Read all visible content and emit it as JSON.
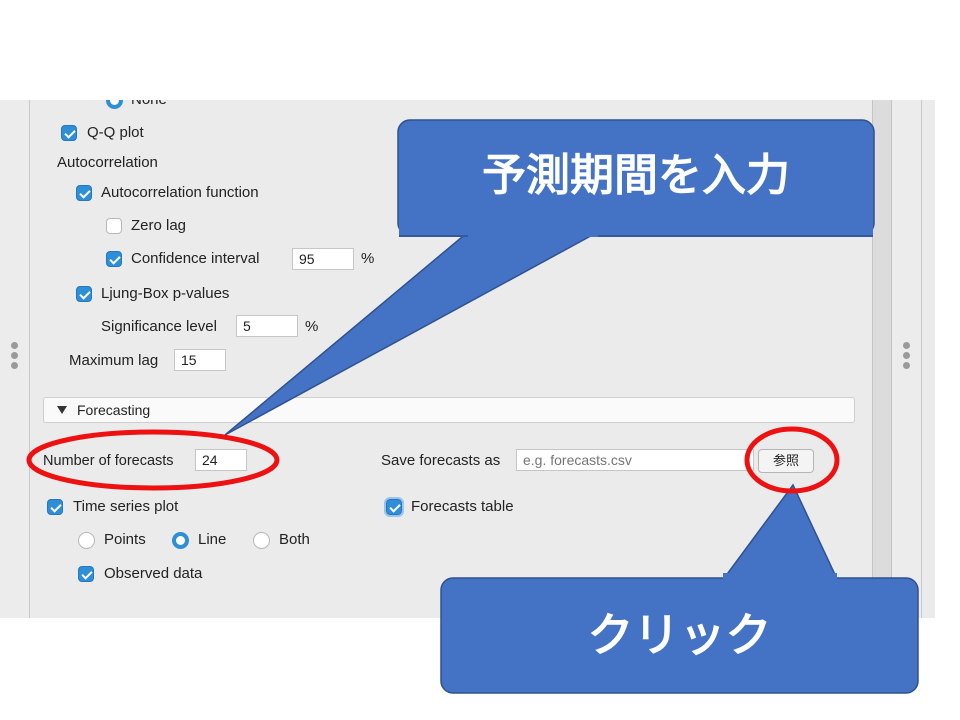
{
  "options": {
    "none_label": "None",
    "qq_plot_label": "Q-Q plot",
    "autocorrelation_heading": "Autocorrelation",
    "acf_label": "Autocorrelation function",
    "zero_lag_label": "Zero lag",
    "confidence_interval_label": "Confidence interval",
    "confidence_interval_value": "95",
    "percent_1": "%",
    "ljung_box_label": "Ljung-Box p-values",
    "significance_level_label": "Significance level",
    "significance_level_value": "5",
    "percent_2": "%",
    "maximum_lag_label": "Maximum lag",
    "maximum_lag_value": "15"
  },
  "forecasting": {
    "section_title": "Forecasting",
    "number_of_forecasts_label": "Number of forecasts",
    "number_of_forecasts_value": "24",
    "save_forecasts_label": "Save forecasts as",
    "save_forecasts_placeholder": "e.g. forecasts.csv",
    "browse_button_label": "参照",
    "time_series_plot_label": "Time series plot",
    "forecasts_table_label": "Forecasts table",
    "points_label": "Points",
    "line_label": "Line",
    "both_label": "Both",
    "observed_data_label": "Observed data"
  },
  "checked": {
    "qq_plot": true,
    "acf": true,
    "zero_lag": false,
    "confidence_interval": true,
    "ljung_box": true,
    "time_series_plot": true,
    "forecasts_table": true,
    "observed_data": true
  },
  "plot_style_selected": "Line",
  "annotations": {
    "callout_top_text": "予測期間を入力",
    "callout_bottom_text": "クリック",
    "callout_color": "#4472c4",
    "highlight_color": "#ee1111"
  },
  "icons": {
    "disclosure": "triangle-down-icon",
    "resize_handles": "vertical-dots-icon"
  }
}
